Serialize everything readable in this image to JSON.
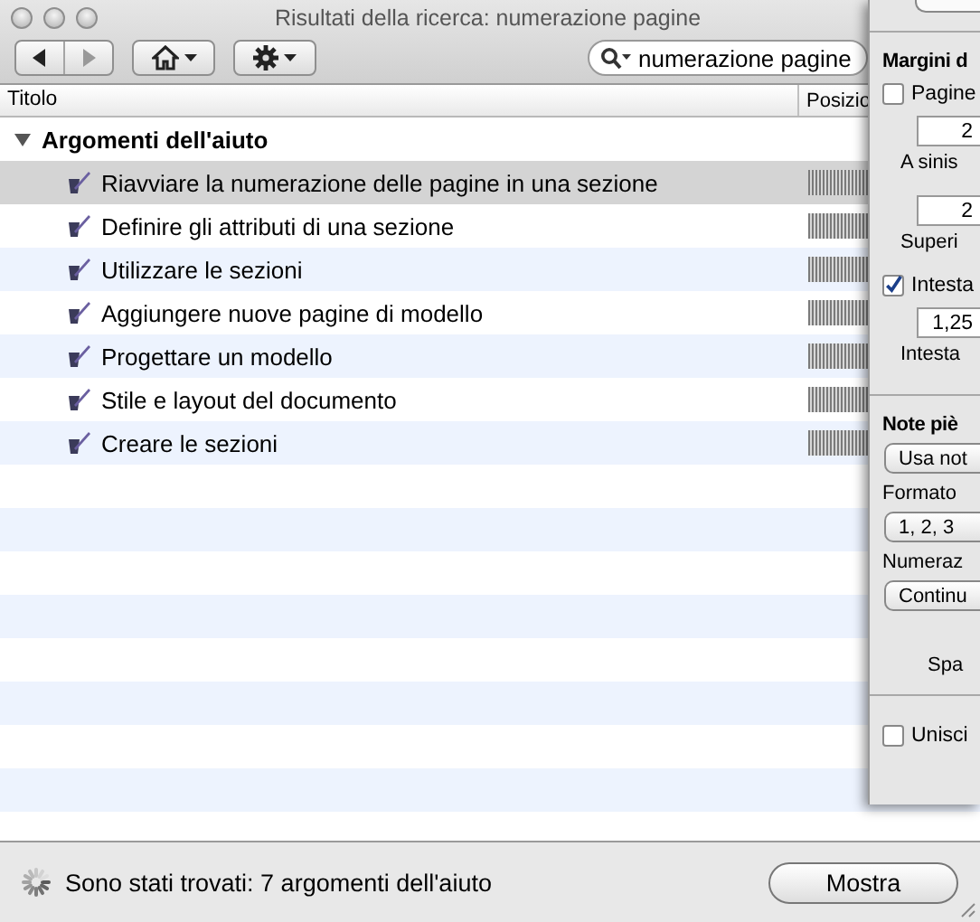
{
  "window": {
    "title": "Risultati della ricerca: numerazione pagine"
  },
  "search": {
    "value": "numerazione pagine"
  },
  "table": {
    "columns": [
      "Titolo",
      "Posizio"
    ],
    "groups": [
      {
        "label": "Argomenti dell'aiuto",
        "expanded": true,
        "items": [
          {
            "label": "Riavviare la numerazione delle pagine in una sezione",
            "selected": true
          },
          {
            "label": "Definire gli attributi di una sezione",
            "selected": false
          },
          {
            "label": "Utilizzare le sezioni",
            "selected": false
          },
          {
            "label": "Aggiungere nuove pagine di modello",
            "selected": false
          },
          {
            "label": "Progettare un modello",
            "selected": false
          },
          {
            "label": "Stile e layout del documento",
            "selected": false
          },
          {
            "label": "Creare le sezioni",
            "selected": false
          }
        ]
      }
    ]
  },
  "status_bar": {
    "text": "Sono stati trovati: 7 argomenti dell'aiuto",
    "button": "Mostra"
  },
  "inspector": {
    "items": [
      {
        "kind": "heading",
        "text": "Margini d"
      },
      {
        "kind": "checkbox",
        "label": "Pagine",
        "checked": false
      },
      {
        "kind": "field",
        "value": "2"
      },
      {
        "kind": "caption",
        "text": "A sinis"
      },
      {
        "kind": "field",
        "value": "2"
      },
      {
        "kind": "caption",
        "text": "Superi"
      },
      {
        "kind": "checkbox",
        "label": "Intesta",
        "checked": true
      },
      {
        "kind": "field",
        "value": "1,25"
      },
      {
        "kind": "caption",
        "text": "Intesta"
      },
      {
        "kind": "divider"
      },
      {
        "kind": "heading",
        "text": "Note piè"
      },
      {
        "kind": "popup",
        "value": "Usa not"
      },
      {
        "kind": "label",
        "text": "Formato"
      },
      {
        "kind": "popup",
        "value": "1, 2, 3"
      },
      {
        "kind": "label",
        "text": "Numeraz"
      },
      {
        "kind": "popup",
        "value": "Continu"
      },
      {
        "kind": "spacer-caption",
        "text": "Spa"
      },
      {
        "kind": "divider"
      },
      {
        "kind": "checkbox",
        "label": "Unisci",
        "checked": false
      }
    ]
  }
}
